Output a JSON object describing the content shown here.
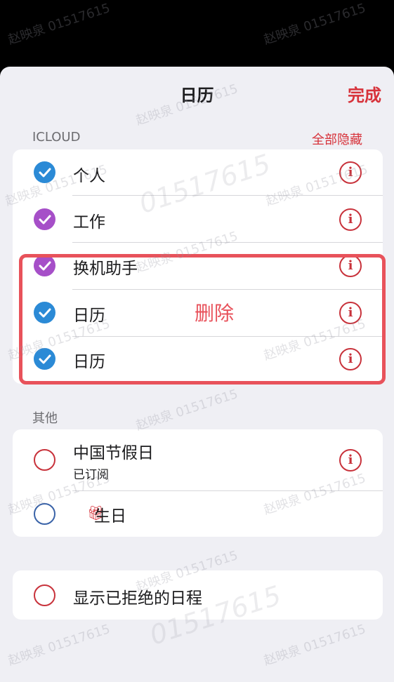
{
  "nav": {
    "title": "日历",
    "done_label": "完成"
  },
  "icloud": {
    "header": "ICLOUD",
    "hide_all_label": "全部隐藏",
    "items": [
      {
        "label": "个人",
        "color": "#2b8ad6",
        "checked": true
      },
      {
        "label": "工作",
        "color": "#a64fc8",
        "checked": true
      },
      {
        "label": "换机助手",
        "color": "#a64fc8",
        "checked": true
      },
      {
        "label": "日历",
        "color": "#2b8ad6",
        "checked": true
      },
      {
        "label": "日历",
        "color": "#2b8ad6",
        "checked": true
      }
    ]
  },
  "annotation": {
    "text": "删除",
    "color": "#e8525b"
  },
  "other": {
    "header": "其他",
    "holidays": {
      "label": "中国节假日",
      "sublabel": "已订阅",
      "color": "#c8323b"
    },
    "birthdays": {
      "label": "生日",
      "icon": "gift-icon",
      "color": "#3a63a8"
    }
  },
  "declined": {
    "label": "显示已拒绝的日程",
    "color": "#c8323b"
  },
  "watermark_text": "赵映泉 01517615",
  "watermark_big_text": "01517615"
}
